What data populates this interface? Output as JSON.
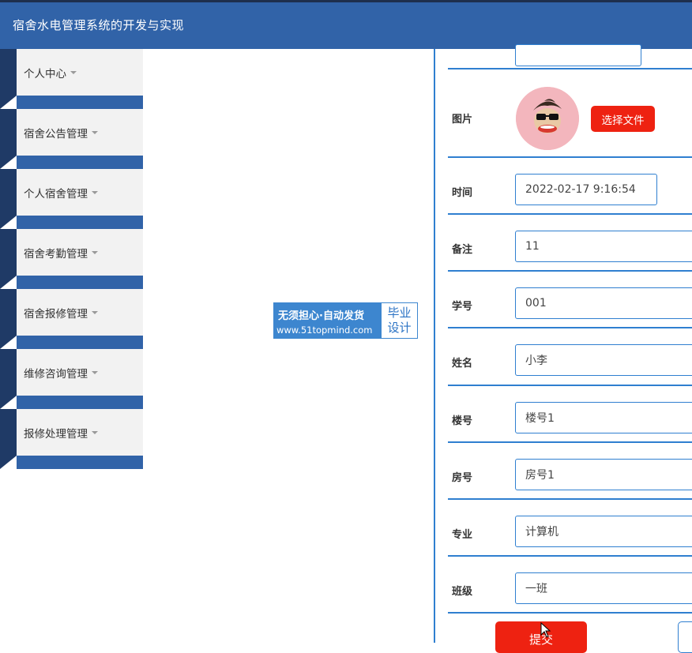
{
  "app": {
    "title": "宿舍水电管理系统的开发与实现"
  },
  "sidebar": {
    "items": [
      {
        "label": "个人中心"
      },
      {
        "label": "宿舍公告管理"
      },
      {
        "label": "个人宿舍管理"
      },
      {
        "label": "宿舍考勤管理"
      },
      {
        "label": "宿舍报修管理"
      },
      {
        "label": "维修咨询管理"
      },
      {
        "label": "报修处理管理"
      }
    ]
  },
  "watermark": {
    "line1": "无须担心·自动发货",
    "line2": "www.51topmind.com",
    "side1": "毕业",
    "side2": "设计"
  },
  "form": {
    "image": {
      "label": "图片",
      "button": "选择文件"
    },
    "fields": [
      {
        "label": "时间",
        "value": "2022-02-17 9:16:54"
      },
      {
        "label": "备注",
        "value": "11"
      },
      {
        "label": "学号",
        "value": "001"
      },
      {
        "label": "姓名",
        "value": "小李"
      },
      {
        "label": "楼号",
        "value": "楼号1"
      },
      {
        "label": "房号",
        "value": "房号1"
      },
      {
        "label": "专业",
        "value": "计算机"
      },
      {
        "label": "班级",
        "value": "一班"
      }
    ],
    "submit": "提交"
  },
  "colors": {
    "header": "#3163a8",
    "accent": "#2f7fd0",
    "button": "#ee2211"
  }
}
